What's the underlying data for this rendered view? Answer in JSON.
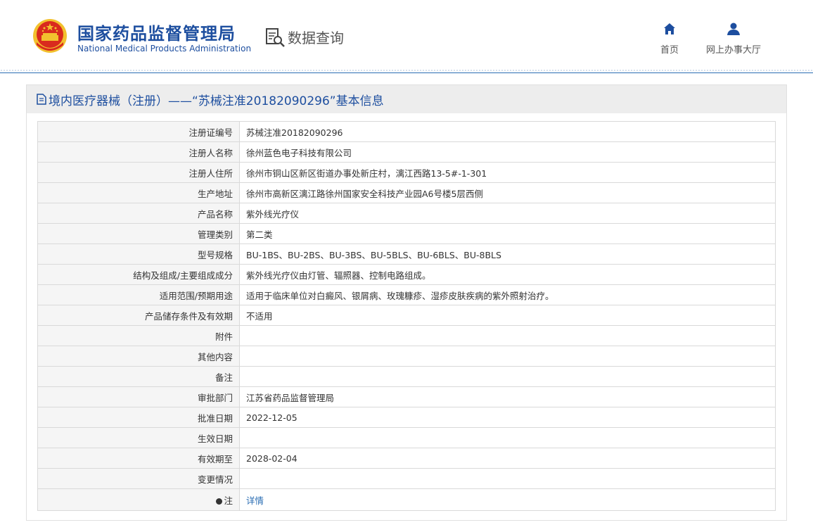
{
  "header": {
    "site_title_cn": "国家药品监督管理局",
    "site_title_en": "National Medical Products Administration",
    "data_query": "数据查询",
    "nav": {
      "home": "首页",
      "online_hall": "网上办事大厅"
    },
    "colors": {
      "brand_blue": "#1d4e9f",
      "emblem_red": "#d92a1e",
      "emblem_gold": "#f2c12e"
    }
  },
  "panel": {
    "title": "境内医疗器械（注册）——“苏械注准20182090296”基本信息"
  },
  "rows": [
    {
      "label": "注册证编号",
      "value": "苏械注准20182090296"
    },
    {
      "label": "注册人名称",
      "value": "徐州蓝色电子科技有限公司"
    },
    {
      "label": "注册人住所",
      "value": "徐州市铜山区新区街道办事处新庄村，漓江西路13-5#-1-301"
    },
    {
      "label": "生产地址",
      "value": "徐州市高新区漓江路徐州国家安全科技产业园A6号楼5层西侧"
    },
    {
      "label": "产品名称",
      "value": "紫外线光疗仪"
    },
    {
      "label": "管理类别",
      "value": "第二类"
    },
    {
      "label": "型号规格",
      "value": "BU-1BS、BU-2BS、BU-3BS、BU-5BLS、BU-6BLS、BU-8BLS"
    },
    {
      "label": "结构及组成/主要组成成分",
      "value": "紫外线光疗仪由灯管、辐照器、控制电路组成。"
    },
    {
      "label": "适用范围/预期用途",
      "value": "适用于临床单位对白癜风、银屑病、玫瑰糠疹、湿疹皮肤疾病的紫外照射治疗。"
    },
    {
      "label": "产品储存条件及有效期",
      "value": "不适用"
    },
    {
      "label": "附件",
      "value": ""
    },
    {
      "label": "其他内容",
      "value": ""
    },
    {
      "label": "备注",
      "value": ""
    },
    {
      "label": "审批部门",
      "value": "江苏省药品监督管理局"
    },
    {
      "label": "批准日期",
      "value": "2022-12-05"
    },
    {
      "label": "生效日期",
      "value": ""
    },
    {
      "label": "有效期至",
      "value": "2028-02-04"
    },
    {
      "label": "变更情况",
      "value": ""
    }
  ],
  "note_row": {
    "label": "注",
    "link": "详情",
    "icon": "info-dot-icon"
  }
}
